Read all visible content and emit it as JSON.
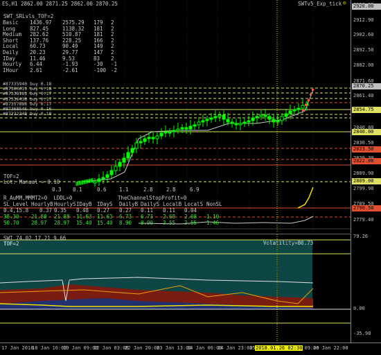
{
  "header": {
    "symbol_info": "ES,H1",
    "ohlc": "2862.00 2871.25 2862.00 2870.25",
    "expert_name": "SWTv5_Exp_tick",
    "smiley": "☺"
  },
  "panel": {
    "title": "SWT_SRLvls_TOF=2",
    "rows": [
      [
        "Basic",
        "1436.97",
        "2575.29",
        "179",
        "2"
      ],
      [
        "Long",
        "827.45",
        "1138.32",
        "181",
        "2"
      ],
      [
        "Medium",
        "282.62",
        "510.87",
        "181",
        "2"
      ],
      [
        "Short",
        "137.76",
        "228.25",
        "166",
        "2"
      ],
      [
        "Local",
        "60.73",
        "90.49",
        "149",
        "2"
      ],
      [
        "Daily",
        "20.23",
        "29.77",
        "147",
        "2"
      ],
      [
        "IDay",
        "11.46",
        "9.53",
        "83",
        "2"
      ],
      [
        "Hourly",
        "6.44",
        "-1.93",
        "-30",
        "-1"
      ],
      [
        "IHour",
        "2.61",
        "-2.61",
        "-100",
        "-2"
      ]
    ],
    "orders": [
      "#87335940 buy 0.18",
      "#87360611 buy 0.18",
      "#87338181 buy 0.17",
      "#87336438 buy 0.17",
      "#87357886 buy 0.17",
      "#87368546 buy 0.16",
      "#87332348 buy 0.18"
    ]
  },
  "lower_block": {
    "tof": "TOF=2",
    "manual": "Lot: Manual = 0.10",
    "mult_row": [
      "0.3",
      "0.1",
      "0.6",
      "1.1",
      "2.8",
      "2.8",
      "6.9"
    ],
    "r_line": "R_AuMM,MMMT2=0  LDDL=0",
    "profit_label": "TheChannelStopProfit=0",
    "stat_header": [
      "SL_Level",
      "HourlyB",
      "HourlyS",
      "IDayB",
      "IDayS",
      "DailyB",
      "DailyS",
      "LocalB",
      "LocalS",
      "NonSL"
    ],
    "stat_rows": [
      [
        "0.4,15.8",
        "0.37",
        "0.35",
        "0.48",
        "0.27",
        "0.27",
        "0.11",
        "0.11",
        "0.04"
      ],
      [
        "38.30",
        "21.88",
        "21.88",
        "11.63",
        "11.63",
        "6.73",
        "6.73",
        "2.68",
        "2.68",
        "1.10"
      ],
      [
        "50.70",
        "28.97",
        "28.97",
        "15.40",
        "15.40",
        "8.90",
        "8.90",
        "3.55",
        "3.55",
        "1.46"
      ]
    ]
  },
  "price_axis": {
    "labels": [
      "2920.00",
      "2912.90",
      "2902.60",
      "2892.50",
      "2882.00",
      "2871.60",
      "2861.40",
      "2851.10",
      "2840.80",
      "2830.50",
      "2820.30",
      "2809.90",
      "2799.90",
      "2789.50",
      "2779.40"
    ],
    "tags": [
      {
        "text": "2920.00",
        "color": "#c0c0c0"
      },
      {
        "text": "2870.25",
        "color": "#c0c0c0"
      },
      {
        "text": "2854.75",
        "color": "#e0e060"
      },
      {
        "text": "2840.00",
        "color": "#e0e060"
      },
      {
        "text": "2823.50",
        "color": "#e05030"
      },
      {
        "text": "2822.00",
        "color": "#e05030"
      },
      {
        "text": "2809.00",
        "color": "#e0e060"
      },
      {
        "text": "2790.50",
        "color": "#e05030"
      }
    ]
  },
  "sub_window": {
    "title": "SWT 74.02 17.21 9.66",
    "volatility": "Volatility=80.73",
    "tof": "TOF=2",
    "axis_labels": [
      "79.26",
      "0.00",
      "-35.98"
    ]
  },
  "time_axis": {
    "labels": [
      "17 Jan 2018",
      "18 Jan 16:00",
      "19 Jan 09:00",
      "22 Jan 03:00",
      "22 Jan 20:00",
      "23 Jan 13:00",
      "24 Jan 06:00",
      "24 Jan 23:00",
      "25 Jan 16:00",
      "26 Jan 09:00",
      "26 Jan 22:00"
    ],
    "cursor_label": "2018.01.26 02:30"
  },
  "colors": {
    "bull_candle": "#00ff00",
    "level_yellow": "#e0e060",
    "level_red": "#e05030",
    "histogram_teal": "#20a0a0",
    "band_red": "#8a1a10"
  }
}
